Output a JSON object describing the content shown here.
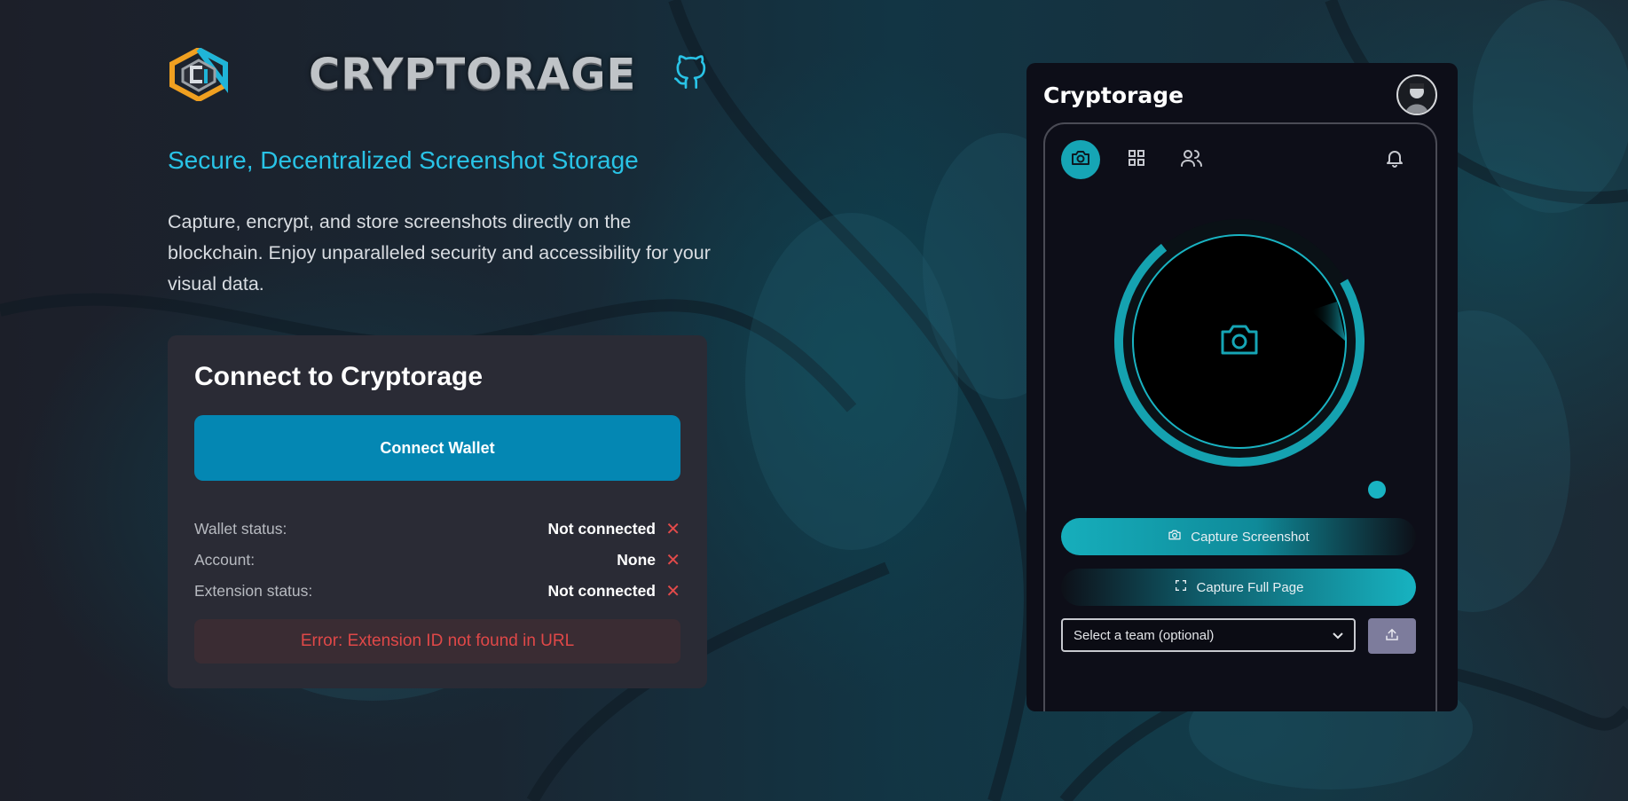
{
  "header": {
    "wordmark": "CRYPTORAGE",
    "logo_icon": "cryptorage-logo-icon",
    "github_icon": "github-icon"
  },
  "hero": {
    "tagline": "Secure, Decentralized Screenshot Storage",
    "description": "Capture, encrypt, and store screenshots directly on the blockchain. Enjoy unparalleled security and accessibility for your visual data."
  },
  "connect_card": {
    "title": "Connect to Cryptorage",
    "connect_button": "Connect Wallet",
    "rows": [
      {
        "label": "Wallet status:",
        "value": "Not connected",
        "mark": "✕"
      },
      {
        "label": "Account:",
        "value": "None",
        "mark": "✕"
      },
      {
        "label": "Extension status:",
        "value": "Not connected",
        "mark": "✕"
      }
    ],
    "error": "Error: Extension ID not found in URL"
  },
  "extension": {
    "title": "Cryptorage",
    "tabs": [
      "camera-icon",
      "grid-icon",
      "users-icon"
    ],
    "bell_icon": "bell-icon",
    "capture_screenshot": "Capture Screenshot",
    "capture_full_page": "Capture Full Page",
    "team_select": "Select a team (optional)",
    "upload_icon": "upload-icon"
  },
  "colors": {
    "accent": "#29c3e6",
    "button": "#0487b3",
    "error": "#e04848",
    "ring": "#16a5b5"
  }
}
